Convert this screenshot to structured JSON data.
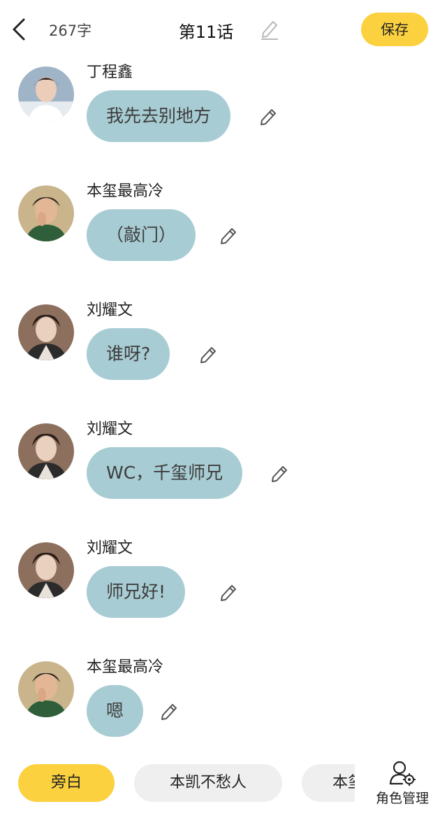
{
  "header": {
    "word_count": "267字",
    "title": "第11话",
    "save_label": "保存"
  },
  "messages": [
    {
      "name": "丁程鑫",
      "text": "我先去别地方"
    },
    {
      "name": "本玺最高冷",
      "text": "（敲门）"
    },
    {
      "name": "刘耀文",
      "text": "谁呀?"
    },
    {
      "name": "刘耀文",
      "text": "WC，千玺师兄"
    },
    {
      "name": "刘耀文",
      "text": "师兄好!"
    },
    {
      "name": "本玺最高冷",
      "text": "嗯"
    }
  ],
  "bottom_bar": {
    "chips": [
      "旁白",
      "本凯不愁人",
      "本玺"
    ],
    "role_manage_label": "角色管理"
  },
  "colors": {
    "accent": "#FBD13F",
    "bubble": "#A8CCD3",
    "chip_inactive": "#EFEFEF"
  }
}
